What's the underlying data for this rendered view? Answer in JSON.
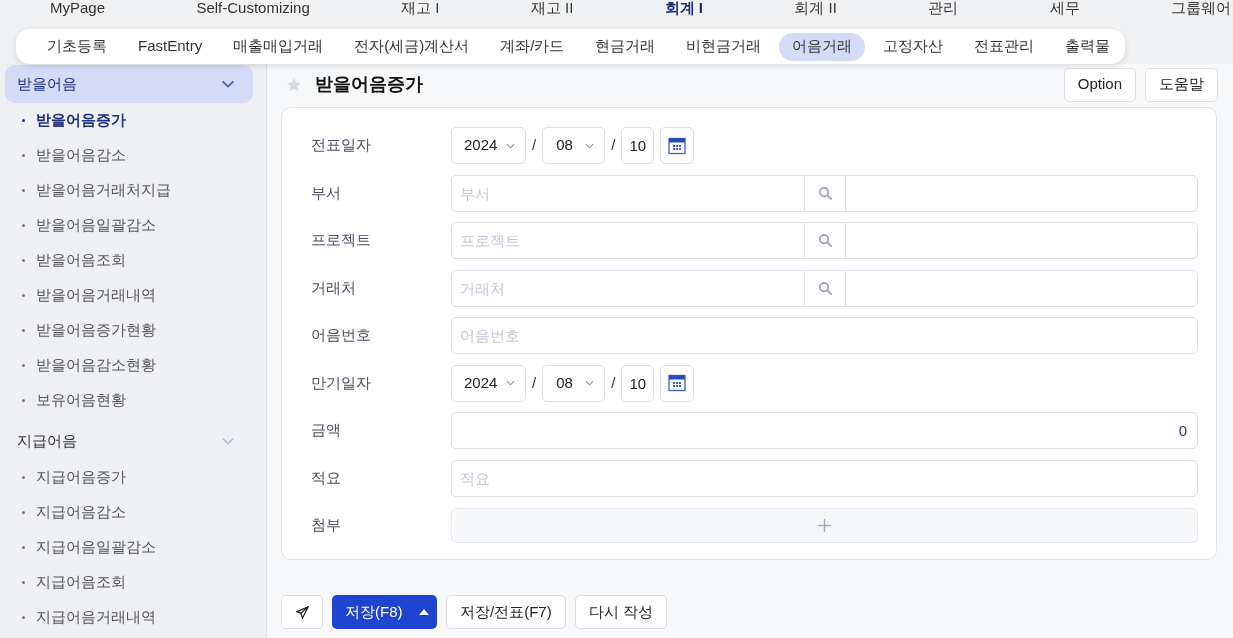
{
  "top_menu": [
    {
      "label": "MyPage",
      "selected": false
    },
    {
      "label": "Self-Customizing",
      "selected": false
    },
    {
      "label": "재고 I",
      "selected": false
    },
    {
      "label": "재고 II",
      "selected": false
    },
    {
      "label": "회계 I",
      "selected": true
    },
    {
      "label": "회계 II",
      "selected": false
    },
    {
      "label": "관리",
      "selected": false
    },
    {
      "label": "세무",
      "selected": false
    },
    {
      "label": "그룹웨어",
      "selected": false
    }
  ],
  "tabs": [
    {
      "label": "기초등록",
      "selected": false
    },
    {
      "label": "FastEntry",
      "selected": false
    },
    {
      "label": "매출매입거래",
      "selected": false
    },
    {
      "label": "전자(세금)계산서",
      "selected": false
    },
    {
      "label": "계좌/카드",
      "selected": false
    },
    {
      "label": "현금거래",
      "selected": false
    },
    {
      "label": "비현금거래",
      "selected": false
    },
    {
      "label": "어음거래",
      "selected": true
    },
    {
      "label": "고정자산",
      "selected": false
    },
    {
      "label": "전표관리",
      "selected": false
    },
    {
      "label": "출력물",
      "selected": false
    }
  ],
  "sidebar": {
    "groups": [
      {
        "label": "받을어음",
        "selected": true,
        "items": [
          {
            "label": "받을어음증가",
            "selected": true
          },
          {
            "label": "받을어음감소",
            "selected": false
          },
          {
            "label": "받을어음거래처지급",
            "selected": false
          },
          {
            "label": "받을어음일괄감소",
            "selected": false
          },
          {
            "label": "받을어음조회",
            "selected": false
          },
          {
            "label": "받을어음거래내역",
            "selected": false
          },
          {
            "label": "받을어음증가현황",
            "selected": false
          },
          {
            "label": "받을어음감소현황",
            "selected": false
          },
          {
            "label": "보유어음현황",
            "selected": false
          }
        ]
      },
      {
        "label": "지급어음",
        "selected": false,
        "items": [
          {
            "label": "지급어음증가",
            "selected": false
          },
          {
            "label": "지급어음감소",
            "selected": false
          },
          {
            "label": "지급어음일괄감소",
            "selected": false
          },
          {
            "label": "지급어음조회",
            "selected": false
          },
          {
            "label": "지급어음거래내역",
            "selected": false
          }
        ]
      }
    ]
  },
  "page": {
    "title": "받을어음증가",
    "buttons": [
      "Option",
      "도움말"
    ]
  },
  "form": [
    {
      "kind": "date",
      "label": "전표일자",
      "year": "2024",
      "separator_1": "/",
      "month": "08",
      "separator_2": "/",
      "day": "10"
    },
    {
      "kind": "lookup",
      "label": "부서",
      "placeholder": "부서"
    },
    {
      "kind": "lookup",
      "label": "프로젝트",
      "placeholder": "프로젝트"
    },
    {
      "kind": "lookup",
      "label": "거래처",
      "placeholder": "거래처"
    },
    {
      "kind": "text",
      "label": "어음번호",
      "placeholder": "어음번호"
    },
    {
      "kind": "date",
      "label": "만기일자",
      "year": "2024",
      "separator_1": "/",
      "month": "08",
      "separator_2": "/",
      "day": "10"
    },
    {
      "kind": "amount",
      "label": "금액",
      "value": "0"
    },
    {
      "kind": "text",
      "label": "적요",
      "placeholder": "적요"
    },
    {
      "kind": "attach",
      "label": "첨부"
    }
  ],
  "actions": {
    "save": "저장(F8)",
    "save_slip": "저장/전표(F7)",
    "reset": "다시 작성"
  }
}
